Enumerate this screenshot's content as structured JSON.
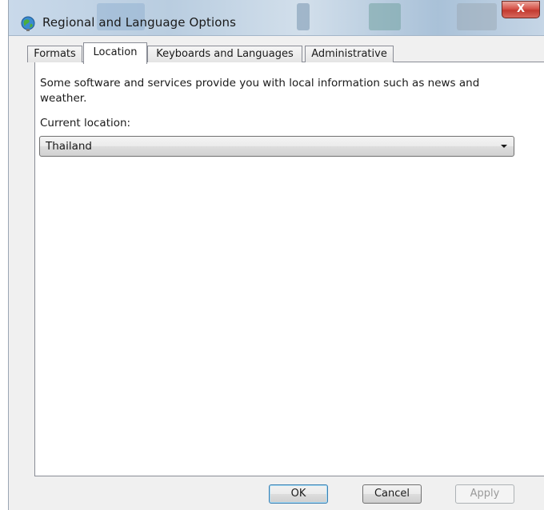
{
  "window": {
    "title": "Regional and Language Options",
    "close_label": "X",
    "icon": "globe-icon"
  },
  "tabs": [
    {
      "label": "Formats",
      "active": false
    },
    {
      "label": "Location",
      "active": true
    },
    {
      "label": "Keyboards and Languages",
      "active": false
    },
    {
      "label": "Administrative",
      "active": false
    }
  ],
  "location": {
    "description": "Some software and services provide you with local information such as news and weather.",
    "current_label": "Current location:",
    "current_value": "Thailand"
  },
  "buttons": {
    "ok": "OK",
    "cancel": "Cancel",
    "apply": "Apply",
    "apply_enabled": false
  },
  "colors": {
    "close_button": "#c23a2f",
    "default_button_border": "#3c7fb1"
  }
}
